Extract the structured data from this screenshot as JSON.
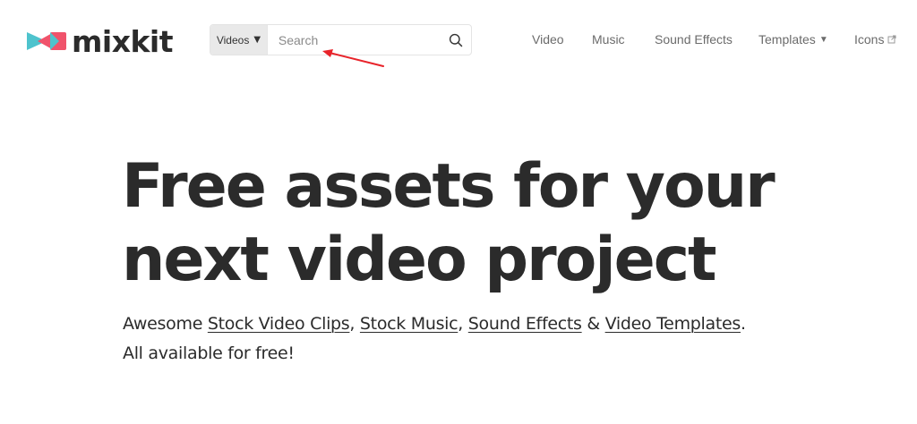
{
  "brand": {
    "name": "mixkit",
    "colors": {
      "teal": "#4ec3cd",
      "pink": "#f0536b",
      "text": "#2b2b2b"
    }
  },
  "search": {
    "type_label": "Videos",
    "placeholder": "Search",
    "value": "",
    "icon": "search-icon"
  },
  "nav": {
    "items": [
      {
        "label": "Video"
      },
      {
        "label": "Music"
      },
      {
        "label": "Sound Effects"
      },
      {
        "label": "Templates",
        "icon": "caret-down-icon"
      },
      {
        "label": "Icons",
        "icon": "external-link-icon"
      }
    ]
  },
  "annotation": {
    "color": "#e8232a",
    "icon": "arrow-icon"
  },
  "hero": {
    "title_line1": "Free assets for your",
    "title_line2": "next video project",
    "sub_prefix": "Awesome ",
    "link_clips": "Stock Video Clips",
    "sep1": ", ",
    "link_music": "Stock Music",
    "sep2": ", ",
    "link_sfx": "Sound Effects",
    "sep3": " & ",
    "link_templates": "Video Templates",
    "sub_end": ".",
    "sub_line2": "All available for free!"
  }
}
